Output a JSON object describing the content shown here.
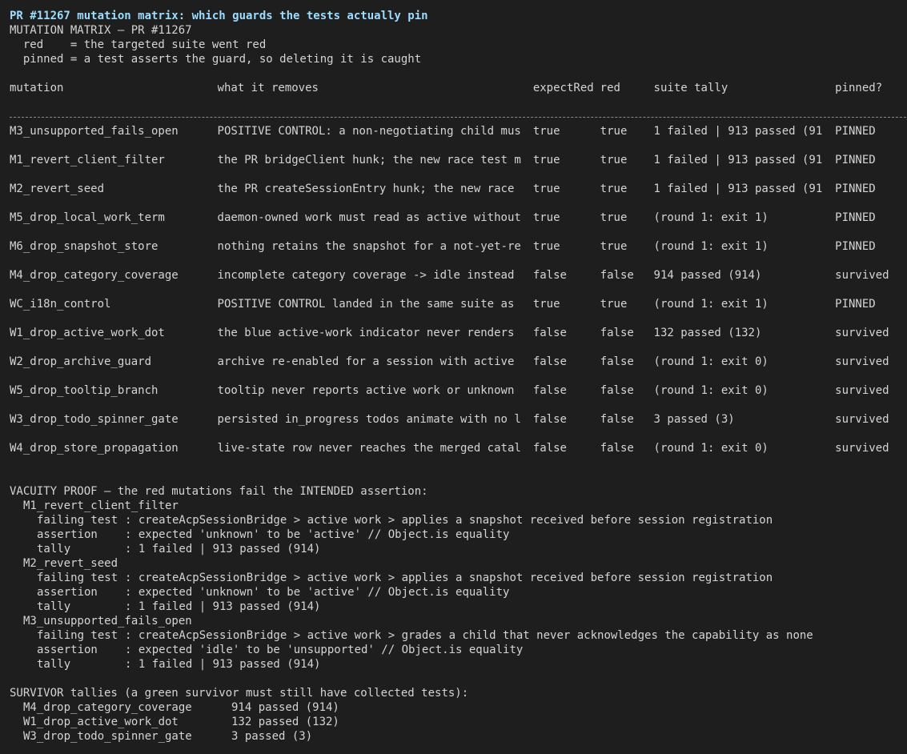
{
  "header": {
    "title": "PR #11267 mutation matrix: which guards the tests actually pin",
    "subtitle": "MUTATION MATRIX — PR #11267",
    "legend_red": "  red    = the targeted suite went red",
    "legend_pinned": "  pinned = a test asserts the guard, so deleting it is caught"
  },
  "table": {
    "columns": [
      "mutation",
      "what it removes",
      "expectRed",
      "red",
      "suite tally",
      "pinned?"
    ],
    "rows": [
      [
        "M3_unsupported_fails_open",
        "POSITIVE CONTROL: a non-negotiating child mus",
        "true",
        "true",
        "1 failed | 913 passed (91",
        "PINNED"
      ],
      [
        "M1_revert_client_filter",
        "the PR bridgeClient hunk; the new race test m",
        "true",
        "true",
        "1 failed | 913 passed (91",
        "PINNED"
      ],
      [
        "M2_revert_seed",
        "the PR createSessionEntry hunk; the new race ",
        "true",
        "true",
        "1 failed | 913 passed (91",
        "PINNED"
      ],
      [
        "M5_drop_local_work_term",
        "daemon-owned work must read as active without",
        "true",
        "true",
        "(round 1: exit 1)",
        "PINNED"
      ],
      [
        "M6_drop_snapshot_store",
        "nothing retains the snapshot for a not-yet-re",
        "true",
        "true",
        "(round 1: exit 1)",
        "PINNED"
      ],
      [
        "M4_drop_category_coverage",
        "incomplete category coverage -> idle instead ",
        "false",
        "false",
        "914 passed (914)",
        "survived"
      ],
      [
        "WC_i18n_control",
        "POSITIVE CONTROL landed in the same suite as ",
        "true",
        "true",
        "(round 1: exit 1)",
        "PINNED"
      ],
      [
        "W1_drop_active_work_dot",
        "the blue active-work indicator never renders ",
        "false",
        "false",
        "132 passed (132)",
        "survived"
      ],
      [
        "W2_drop_archive_guard",
        "archive re-enabled for a session with active ",
        "false",
        "false",
        "(round 1: exit 0)",
        "survived"
      ],
      [
        "W5_drop_tooltip_branch",
        "tooltip never reports active work or unknown ",
        "false",
        "false",
        "(round 1: exit 0)",
        "survived"
      ],
      [
        "W3_drop_todo_spinner_gate",
        "persisted in_progress todos animate with no l",
        "false",
        "false",
        "3 passed (3)",
        "survived"
      ],
      [
        "W4_drop_store_propagation",
        "live-state row never reaches the merged catal",
        "false",
        "false",
        "(round 1: exit 0)",
        "survived"
      ]
    ]
  },
  "vacuity": {
    "heading": "VACUITY PROOF — the red mutations fail the INTENDED assertion:",
    "labels": {
      "failing": "failing test",
      "assertion": "assertion",
      "tally": "tally"
    },
    "entries": [
      {
        "name": "M1_revert_client_filter",
        "failing": "createAcpSessionBridge > active work > applies a snapshot received before session registration",
        "assertion": "expected 'unknown' to be 'active' // Object.is equality",
        "tally": "1 failed | 913 passed (914)"
      },
      {
        "name": "M2_revert_seed",
        "failing": "createAcpSessionBridge > active work > applies a snapshot received before session registration",
        "assertion": "expected 'unknown' to be 'active' // Object.is equality",
        "tally": "1 failed | 913 passed (914)"
      },
      {
        "name": "M3_unsupported_fails_open",
        "failing": "createAcpSessionBridge > active work > grades a child that never acknowledges the capability as none",
        "assertion": "expected 'idle' to be 'unsupported' // Object.is equality",
        "tally": "1 failed | 913 passed (914)"
      }
    ]
  },
  "survivors": {
    "heading": "SURVIVOR tallies (a green survivor must still have collected tests):",
    "rows": [
      {
        "name": "M4_drop_category_coverage",
        "tally": "914 passed (914)"
      },
      {
        "name": "W1_drop_active_work_dot",
        "tally": "132 passed (132)"
      },
      {
        "name": "W3_drop_todo_spinner_gate",
        "tally": "3 passed (3)"
      }
    ]
  },
  "colors": {
    "background": "#1e1e1e",
    "text": "#d4d4d4",
    "title": "#9cdcfe"
  }
}
